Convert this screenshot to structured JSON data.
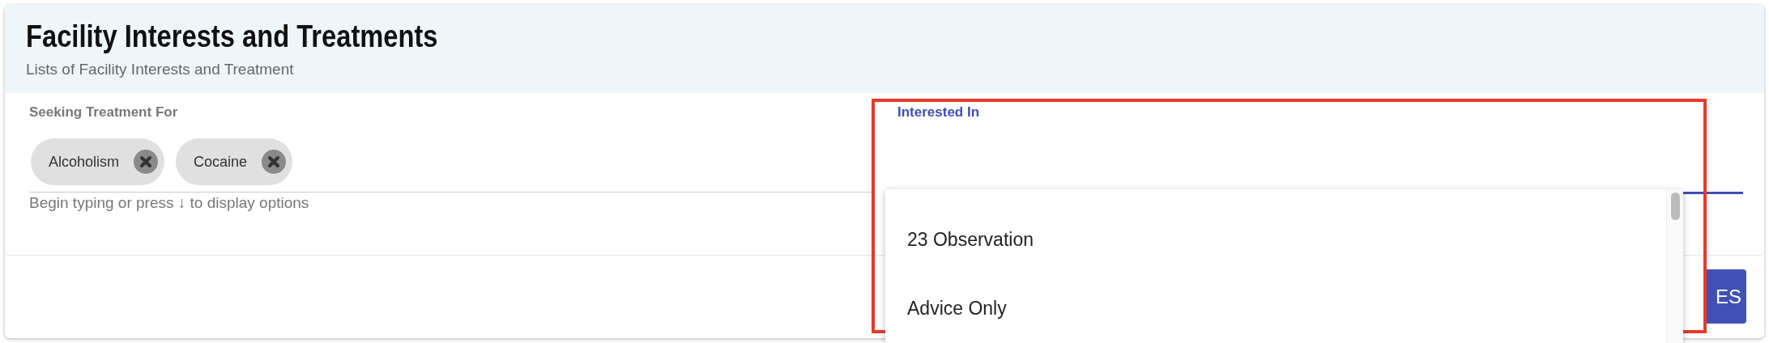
{
  "header": {
    "title": "Facility Interests and Treatments",
    "subtitle": "Lists of Facility Interests and Treatment"
  },
  "seeking_field": {
    "label": "Seeking Treatment For",
    "chips": [
      {
        "label": "Alcoholism"
      },
      {
        "label": "Cocaine"
      }
    ],
    "helper": "Begin typing or press ↓ to display options",
    "focused": false
  },
  "interested_field": {
    "label": "Interested In",
    "focused": true,
    "highlighted": true
  },
  "dropdown": {
    "options": [
      {
        "label": "23 Observation",
        "selected": false
      },
      {
        "label": "Advice Only",
        "selected": false
      }
    ]
  },
  "save_button": {
    "label": "ES"
  }
}
